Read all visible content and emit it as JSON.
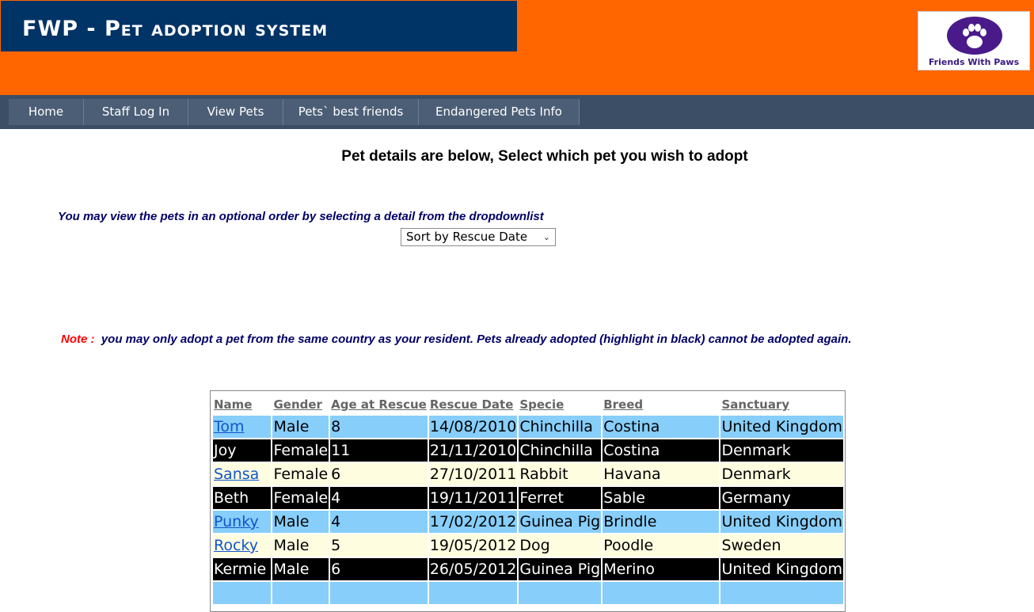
{
  "header": {
    "title": "FWP - Pet adoption system",
    "logo_text": "Friends With Paws"
  },
  "nav": {
    "items": [
      {
        "label": "Home"
      },
      {
        "label": "Staff Log In"
      },
      {
        "label": "View Pets"
      },
      {
        "label": "Pets` best friends"
      },
      {
        "label": "Endangered Pets Info"
      }
    ]
  },
  "main": {
    "heading": "Pet details are below, Select which pet you wish to adopt",
    "intro": "You may view the pets in an optional order by selecting a detail from the dropdownlist",
    "sort_selected": "Sort by Rescue Date",
    "note_label": "Note :",
    "note_text": "you may only adopt a pet from the same country as your resident. Pets already adopted (highlight in black) cannot be adopted again."
  },
  "table": {
    "headers": [
      "Name",
      "Gender",
      "Age at Rescue",
      "Rescue Date",
      "Specie",
      "Breed",
      "Sanctuary"
    ],
    "rows": [
      {
        "name": "Tom",
        "gender": "Male",
        "age": "8",
        "date": "14/08/2010",
        "specie": "Chinchilla",
        "breed": "Costina",
        "sanctuary": "United Kingdom"
      },
      {
        "name": "Joy",
        "gender": "Female",
        "age": "11",
        "date": "21/11/2010",
        "specie": "Chinchilla",
        "breed": "Costina",
        "sanctuary": "Denmark"
      },
      {
        "name": "Sansa",
        "gender": "Female",
        "age": "6",
        "date": "27/10/2011",
        "specie": "Rabbit",
        "breed": "Havana",
        "sanctuary": "Denmark"
      },
      {
        "name": "Beth",
        "gender": "Female",
        "age": "4",
        "date": "19/11/2011",
        "specie": "Ferret",
        "breed": "Sable",
        "sanctuary": "Germany"
      },
      {
        "name": "Punky",
        "gender": "Male",
        "age": "4",
        "date": "17/02/2012",
        "specie": "Guinea Pig",
        "breed": "Brindle",
        "sanctuary": "United Kingdom"
      },
      {
        "name": "Rocky",
        "gender": "Male",
        "age": "5",
        "date": "19/05/2012",
        "specie": "Dog",
        "breed": "Poodle",
        "sanctuary": "Sweden"
      },
      {
        "name": "Kermie",
        "gender": "Male",
        "age": "6",
        "date": "26/05/2012",
        "specie": "Guinea Pig",
        "breed": "Merino",
        "sanctuary": "United Kingdom"
      }
    ]
  },
  "colors": {
    "header_orange": "#ff6600",
    "title_blue": "#003366",
    "nav_bg": "#3b4e66",
    "row_blue": "#87cefa",
    "row_black": "#000000",
    "row_cream": "#fffde0",
    "note_red": "#ff0000",
    "text_navy": "#000066"
  },
  "icons": {
    "logo": "paw-print-icon",
    "dropdown": "chevron-down-icon"
  }
}
